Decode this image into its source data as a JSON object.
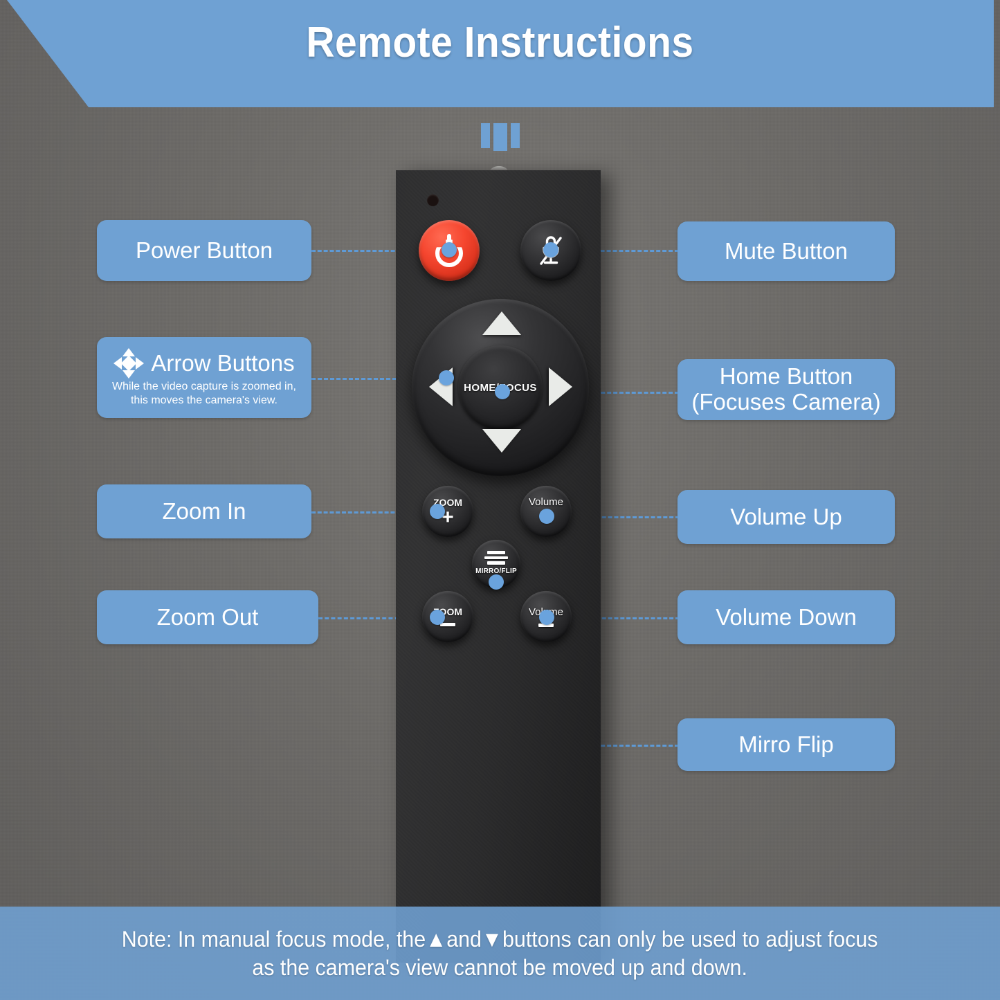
{
  "header": {
    "title": "Remote Instructions",
    "banner_color": "#6fa1d3",
    "title_color": "#ffffff"
  },
  "background": {
    "wall_color": "#6d6b68",
    "accent_color": "#6fa1d3",
    "connector_color": "#5e9ad6",
    "node_color": "#6aa3dd"
  },
  "device": {
    "name": "remote-control",
    "body_color": "#2b2b2c",
    "buttons": [
      {
        "id": "power",
        "label": "",
        "icon": "power-icon",
        "color": "#f5462f"
      },
      {
        "id": "mute",
        "label": "",
        "icon": "mic-muted-icon",
        "color": "#2b2b2c"
      },
      {
        "id": "up",
        "label": "",
        "icon": "triangle-up-icon"
      },
      {
        "id": "down",
        "label": "",
        "icon": "triangle-down-icon"
      },
      {
        "id": "left",
        "label": "",
        "icon": "triangle-left-icon"
      },
      {
        "id": "right",
        "label": "",
        "icon": "triangle-right-icon"
      },
      {
        "id": "home",
        "label": "HOME/FOCUS",
        "icon": "home-focus-icon"
      },
      {
        "id": "zoom-in",
        "label": "ZOOM",
        "symbol": "+"
      },
      {
        "id": "volume-up",
        "label": "Volume",
        "symbol": "+"
      },
      {
        "id": "zoom-out",
        "label": "ZOOM",
        "symbol": "—"
      },
      {
        "id": "volume-down",
        "label": "Volume",
        "symbol": "—"
      },
      {
        "id": "mirror-flip",
        "label": "MIRRO/FLIP",
        "icon": "mirror-flip-icon"
      }
    ],
    "dpad_center_label": "HOME/FOCUS",
    "zoom_label": "ZOOM",
    "volume_label": "Volume",
    "plus_symbol": "+",
    "mirror_label": "MIRRO/FLIP"
  },
  "callouts": {
    "power": {
      "title": "Power Button"
    },
    "arrows": {
      "title": "Arrow Buttons",
      "subtitle": "While the video capture is zoomed in,\nthis moves the camera's view.",
      "icon": "four-way-arrows-icon"
    },
    "zoom_in": {
      "title": "Zoom In"
    },
    "zoom_out": {
      "title": "Zoom Out"
    },
    "mute": {
      "title": "Mute Button"
    },
    "home": {
      "line1": "Home Button",
      "line2": "(Focuses Camera)"
    },
    "volume_up": {
      "title": "Volume Up"
    },
    "volume_down": {
      "title": "Volume Down"
    },
    "mirror_flip": {
      "title": "Mirro Flip"
    }
  },
  "note": {
    "text": "Note: In manual focus mode, the▲and▼buttons can only be used to adjust focus\nas the camera's view cannot be moved up and down."
  }
}
